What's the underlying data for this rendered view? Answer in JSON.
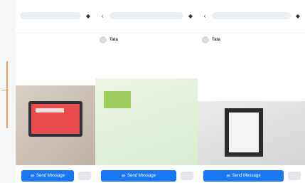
{
  "phones": [
    {
      "status": "",
      "search": "",
      "nav": [
        "",
        "",
        "",
        ""
      ],
      "post": {
        "name": "",
        "sub": "",
        "text": ""
      },
      "cta": "Send Message"
    },
    {
      "status": "",
      "search": "",
      "nav": [
        "",
        "",
        "",
        ""
      ],
      "post": {
        "name": "Tata",
        "sub": "",
        "text": ""
      },
      "cta": "Send Message"
    },
    {
      "status": "",
      "search": "",
      "nav": [
        "",
        "",
        "",
        ""
      ],
      "post": {
        "name": "Tata",
        "sub": "",
        "text": ""
      },
      "cta": "Send Message"
    }
  ],
  "colors": {
    "accent": "#1877f2",
    "orange": "#e0a260"
  }
}
